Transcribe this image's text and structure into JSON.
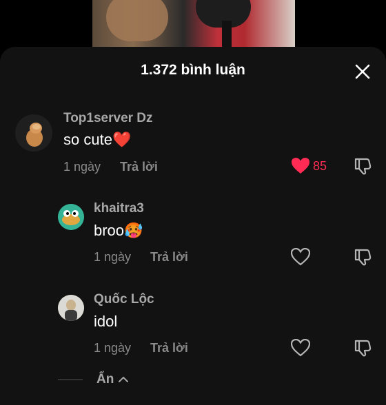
{
  "header": {
    "title": "1.372 bình luận"
  },
  "comments": [
    {
      "username": "Top1server Dz",
      "text": "so cute",
      "emoji": "❤️",
      "time": "1 ngày",
      "reply_label": "Trả lời",
      "like_count": "85"
    },
    {
      "username": "khaitra3",
      "text": "broo",
      "emoji": "🥵",
      "time": "1 ngày",
      "reply_label": "Trả lời"
    },
    {
      "username": "Quốc Lộc",
      "text": "idol",
      "time": "1 ngày",
      "reply_label": "Trả lời"
    }
  ],
  "collapse": {
    "label": "Ẩn"
  },
  "colors": {
    "like": "#fe2c55",
    "sheet": "#121212",
    "muted": "#8a8a8a"
  }
}
